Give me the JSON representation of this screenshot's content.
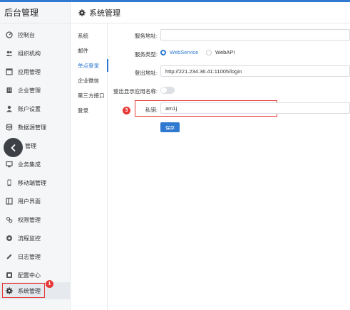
{
  "app": {
    "title": "后台管理"
  },
  "header": {
    "title": "系统管理"
  },
  "sidebar": {
    "items": [
      {
        "label": "控制台"
      },
      {
        "label": "组织机构"
      },
      {
        "label": "应用管理"
      },
      {
        "label": "企业管理"
      },
      {
        "label": "账户设置"
      },
      {
        "label": "数据源管理"
      },
      {
        "label": "管理"
      },
      {
        "label": "业务集成"
      },
      {
        "label": "移动端管理"
      },
      {
        "label": "用户界面"
      },
      {
        "label": "权限管理"
      },
      {
        "label": "流程监控"
      },
      {
        "label": "日志管理"
      },
      {
        "label": "配置中心"
      },
      {
        "label": "系统管理"
      }
    ]
  },
  "submenu": {
    "items": [
      {
        "label": "系统"
      },
      {
        "label": "邮件"
      },
      {
        "label": "单点登录"
      },
      {
        "label": "企业微信"
      },
      {
        "label": "第三方接口"
      },
      {
        "label": "登录"
      }
    ]
  },
  "form": {
    "service_address_label": "服务地址:",
    "service_address_value": "",
    "service_type_label": "服务类型:",
    "option_webservice": "WebService",
    "option_webapi": "WebAPI",
    "logout_address_label": "登出地址:",
    "logout_address_value": "http://221.234.36.41:11005/login",
    "show_app_name_label": "登出显示应用名称:",
    "private_key_label": "私钥:",
    "private_key_value": "am1j",
    "save_label": "保存"
  },
  "badges": {
    "sidebar_marker": "1",
    "form_marker": "3"
  },
  "colors": {
    "accent": "#2f7ad0",
    "marker": "#e53935"
  }
}
